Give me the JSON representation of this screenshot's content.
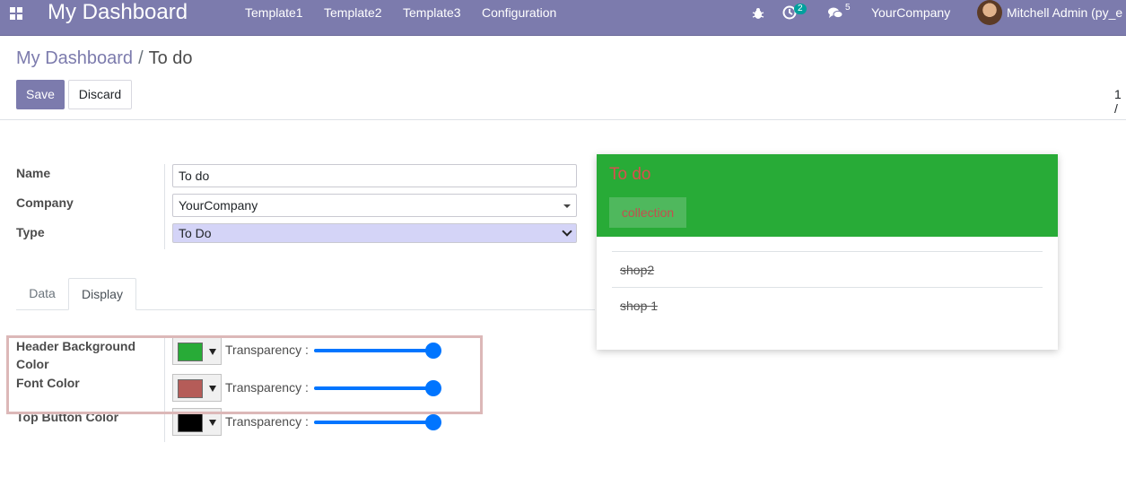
{
  "navbar": {
    "brand": "My Dashboard",
    "menu": [
      "Template1",
      "Template2",
      "Template3",
      "Configuration"
    ],
    "activity_count": "2",
    "messages_count": "5",
    "company": "YourCompany",
    "user": "Mitchell Admin (py_e",
    "icons": [
      "apps-grid-icon",
      "bug-icon",
      "activity-clock-icon",
      "chat-bubbles-icon"
    ]
  },
  "breadcrumb": {
    "parent": "My Dashboard",
    "separator": "/",
    "current": "To do"
  },
  "actions": {
    "save": "Save",
    "discard": "Discard"
  },
  "pager": "1 /",
  "form": {
    "name_label": "Name",
    "name_value": "To do",
    "company_label": "Company",
    "company_value": "YourCompany",
    "type_label": "Type",
    "type_value": "To Do"
  },
  "tabs": [
    "Data",
    "Display"
  ],
  "active_tab": "Display",
  "display": {
    "rows": [
      {
        "label": "Header Background Color",
        "color": "#28ab37",
        "transparency_label": "Transparency :",
        "transparency": 1.0
      },
      {
        "label": "Font Color",
        "color": "#b55c58",
        "transparency_label": "Transparency :",
        "transparency": 1.0
      },
      {
        "label": "Top Button Color",
        "color": "#000000",
        "transparency_label": "Transparency :",
        "transparency": 1.0
      }
    ]
  },
  "preview": {
    "title": "To do",
    "button": "collection",
    "items": [
      "shop2",
      "shop 1"
    ],
    "header_bg": "#28ab37",
    "title_color": "#d94f4f",
    "button_bg": "#4fb85d",
    "button_text_color": "#c44f4f"
  },
  "colors": {
    "navbar": "#7c7bad",
    "primary": "#7c7bad",
    "slider": "#0075ff"
  }
}
